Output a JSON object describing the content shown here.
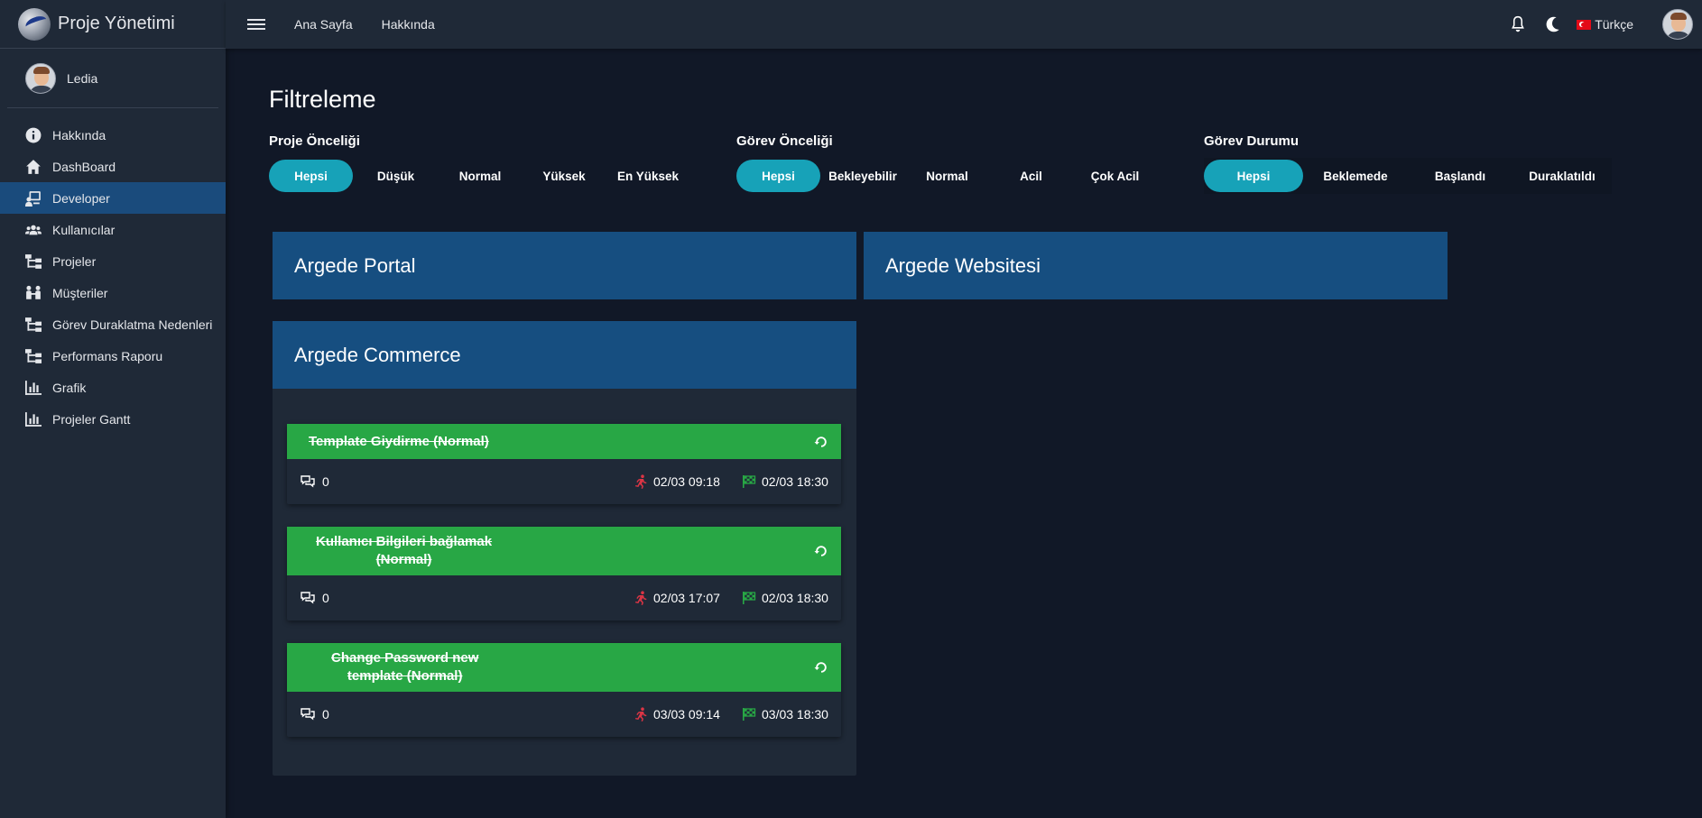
{
  "app": {
    "title": "Proje Yönetimi"
  },
  "user": {
    "name": "Ledia"
  },
  "sidebar": {
    "items": [
      {
        "label": "Hakkında",
        "icon": "info-icon"
      },
      {
        "label": "DashBoard",
        "icon": "home-icon"
      },
      {
        "label": "Developer",
        "icon": "developer-icon",
        "active": true
      },
      {
        "label": "Kullanıcılar",
        "icon": "users-icon"
      },
      {
        "label": "Projeler",
        "icon": "sitemap-icon"
      },
      {
        "label": "Müşteriler",
        "icon": "customers-icon"
      },
      {
        "label": "Görev Duraklatma Nedenleri",
        "icon": "sitemap-icon"
      },
      {
        "label": "Performans Raporu",
        "icon": "sitemap-icon"
      },
      {
        "label": "Grafik",
        "icon": "chart-icon"
      },
      {
        "label": "Projeler Gantt",
        "icon": "chart-icon"
      }
    ]
  },
  "topbar": {
    "links": [
      "Ana Sayfa",
      "Hakkında"
    ],
    "language": "Türkçe"
  },
  "filters": {
    "title": "Filtreleme",
    "project_priority": {
      "label": "Proje Önceliği",
      "options": [
        "Hepsi",
        "Düşük",
        "Normal",
        "Yüksek",
        "En Yüksek"
      ],
      "selected": "Hepsi"
    },
    "task_priority": {
      "label": "Görev Önceliği",
      "options": [
        "Hepsi",
        "Bekleyebilir",
        "Normal",
        "Acil",
        "Çok Acil"
      ],
      "selected": "Hepsi"
    },
    "task_status": {
      "label": "Görev Durumu",
      "options": [
        "Hepsi",
        "Beklemede",
        "Başlandı",
        "Duraklatıldı"
      ],
      "selected": "Hepsi"
    }
  },
  "projects": [
    {
      "name": "Argede Portal"
    },
    {
      "name": "Argede Websitesi"
    },
    {
      "name": "Argede Commerce"
    }
  ],
  "tasks": [
    {
      "title_lines": [
        "Template Giydirme (Normal)"
      ],
      "comments": "0",
      "start": "02/03 09:18",
      "end": "02/03 18:30"
    },
    {
      "title_lines": [
        "Kullanıcı Bilgileri bağlamak",
        "(Normal)"
      ],
      "comments": "0",
      "start": "02/03 17:07",
      "end": "02/03 18:30"
    },
    {
      "title_lines": [
        "Change Password new",
        "template (Normal)"
      ],
      "comments": "0",
      "start": "03/03 09:14",
      "end": "03/03 18:30"
    }
  ],
  "colors": {
    "accent": "#17a2b8",
    "header_blue": "#164e80",
    "task_green": "#28a745",
    "start_red": "#dc3545"
  }
}
